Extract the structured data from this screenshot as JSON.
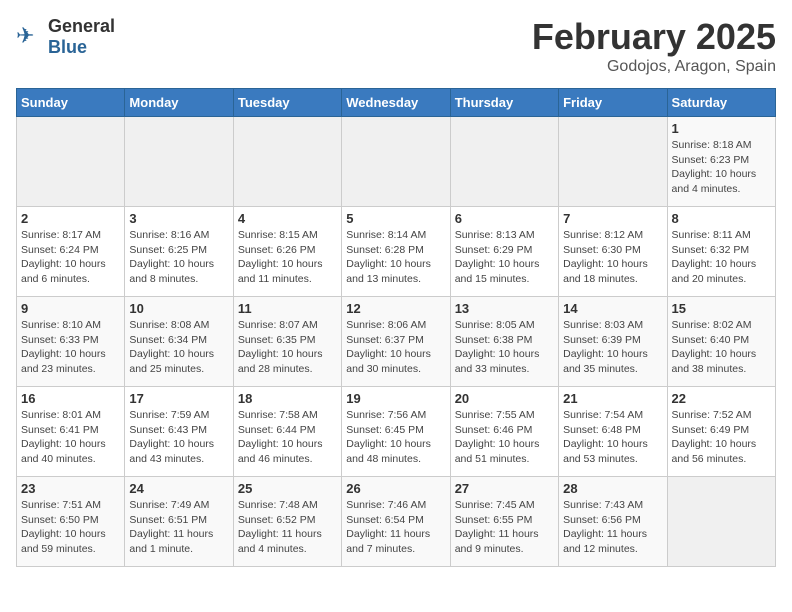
{
  "logo": {
    "general": "General",
    "blue": "Blue"
  },
  "header": {
    "title": "February 2025",
    "subtitle": "Godojos, Aragon, Spain"
  },
  "weekdays": [
    "Sunday",
    "Monday",
    "Tuesday",
    "Wednesday",
    "Thursday",
    "Friday",
    "Saturday"
  ],
  "weeks": [
    [
      {
        "day": "",
        "info": ""
      },
      {
        "day": "",
        "info": ""
      },
      {
        "day": "",
        "info": ""
      },
      {
        "day": "",
        "info": ""
      },
      {
        "day": "",
        "info": ""
      },
      {
        "day": "",
        "info": ""
      },
      {
        "day": "1",
        "info": "Sunrise: 8:18 AM\nSunset: 6:23 PM\nDaylight: 10 hours\nand 4 minutes."
      }
    ],
    [
      {
        "day": "2",
        "info": "Sunrise: 8:17 AM\nSunset: 6:24 PM\nDaylight: 10 hours\nand 6 minutes."
      },
      {
        "day": "3",
        "info": "Sunrise: 8:16 AM\nSunset: 6:25 PM\nDaylight: 10 hours\nand 8 minutes."
      },
      {
        "day": "4",
        "info": "Sunrise: 8:15 AM\nSunset: 6:26 PM\nDaylight: 10 hours\nand 11 minutes."
      },
      {
        "day": "5",
        "info": "Sunrise: 8:14 AM\nSunset: 6:28 PM\nDaylight: 10 hours\nand 13 minutes."
      },
      {
        "day": "6",
        "info": "Sunrise: 8:13 AM\nSunset: 6:29 PM\nDaylight: 10 hours\nand 15 minutes."
      },
      {
        "day": "7",
        "info": "Sunrise: 8:12 AM\nSunset: 6:30 PM\nDaylight: 10 hours\nand 18 minutes."
      },
      {
        "day": "8",
        "info": "Sunrise: 8:11 AM\nSunset: 6:32 PM\nDaylight: 10 hours\nand 20 minutes."
      }
    ],
    [
      {
        "day": "9",
        "info": "Sunrise: 8:10 AM\nSunset: 6:33 PM\nDaylight: 10 hours\nand 23 minutes."
      },
      {
        "day": "10",
        "info": "Sunrise: 8:08 AM\nSunset: 6:34 PM\nDaylight: 10 hours\nand 25 minutes."
      },
      {
        "day": "11",
        "info": "Sunrise: 8:07 AM\nSunset: 6:35 PM\nDaylight: 10 hours\nand 28 minutes."
      },
      {
        "day": "12",
        "info": "Sunrise: 8:06 AM\nSunset: 6:37 PM\nDaylight: 10 hours\nand 30 minutes."
      },
      {
        "day": "13",
        "info": "Sunrise: 8:05 AM\nSunset: 6:38 PM\nDaylight: 10 hours\nand 33 minutes."
      },
      {
        "day": "14",
        "info": "Sunrise: 8:03 AM\nSunset: 6:39 PM\nDaylight: 10 hours\nand 35 minutes."
      },
      {
        "day": "15",
        "info": "Sunrise: 8:02 AM\nSunset: 6:40 PM\nDaylight: 10 hours\nand 38 minutes."
      }
    ],
    [
      {
        "day": "16",
        "info": "Sunrise: 8:01 AM\nSunset: 6:41 PM\nDaylight: 10 hours\nand 40 minutes."
      },
      {
        "day": "17",
        "info": "Sunrise: 7:59 AM\nSunset: 6:43 PM\nDaylight: 10 hours\nand 43 minutes."
      },
      {
        "day": "18",
        "info": "Sunrise: 7:58 AM\nSunset: 6:44 PM\nDaylight: 10 hours\nand 46 minutes."
      },
      {
        "day": "19",
        "info": "Sunrise: 7:56 AM\nSunset: 6:45 PM\nDaylight: 10 hours\nand 48 minutes."
      },
      {
        "day": "20",
        "info": "Sunrise: 7:55 AM\nSunset: 6:46 PM\nDaylight: 10 hours\nand 51 minutes."
      },
      {
        "day": "21",
        "info": "Sunrise: 7:54 AM\nSunset: 6:48 PM\nDaylight: 10 hours\nand 53 minutes."
      },
      {
        "day": "22",
        "info": "Sunrise: 7:52 AM\nSunset: 6:49 PM\nDaylight: 10 hours\nand 56 minutes."
      }
    ],
    [
      {
        "day": "23",
        "info": "Sunrise: 7:51 AM\nSunset: 6:50 PM\nDaylight: 10 hours\nand 59 minutes."
      },
      {
        "day": "24",
        "info": "Sunrise: 7:49 AM\nSunset: 6:51 PM\nDaylight: 11 hours\nand 1 minute."
      },
      {
        "day": "25",
        "info": "Sunrise: 7:48 AM\nSunset: 6:52 PM\nDaylight: 11 hours\nand 4 minutes."
      },
      {
        "day": "26",
        "info": "Sunrise: 7:46 AM\nSunset: 6:54 PM\nDaylight: 11 hours\nand 7 minutes."
      },
      {
        "day": "27",
        "info": "Sunrise: 7:45 AM\nSunset: 6:55 PM\nDaylight: 11 hours\nand 9 minutes."
      },
      {
        "day": "28",
        "info": "Sunrise: 7:43 AM\nSunset: 6:56 PM\nDaylight: 11 hours\nand 12 minutes."
      },
      {
        "day": "",
        "info": ""
      }
    ]
  ]
}
